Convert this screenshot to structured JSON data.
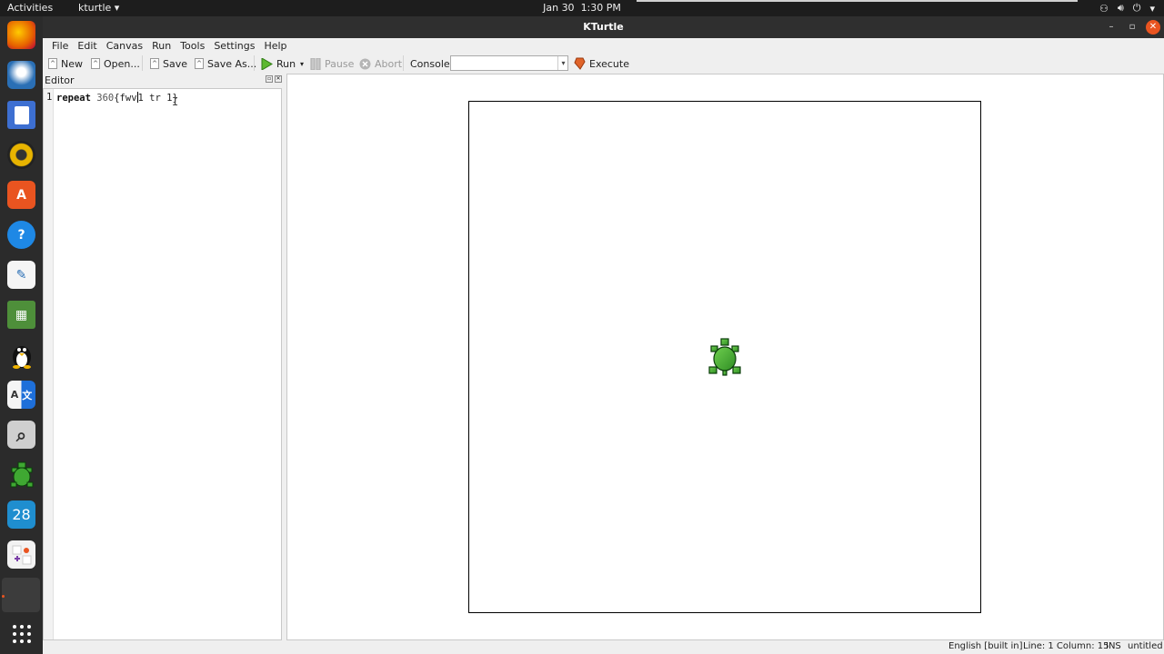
{
  "topbar": {
    "activities": "Activities",
    "app_menu": "kturtle ▾",
    "date": "Jan 30",
    "time": "1:30 PM"
  },
  "dock": {
    "apps": [
      {
        "name": "firefox-icon",
        "glyph": "",
        "color": "#e66000"
      },
      {
        "name": "thunderbird-icon",
        "glyph": "",
        "color": "#2a6fb5"
      },
      {
        "name": "files-icon",
        "glyph": "",
        "color": "#3d6fd1"
      },
      {
        "name": "rhythmbox-icon",
        "glyph": "",
        "color": "#e8b400"
      },
      {
        "name": "software-icon",
        "glyph": "A",
        "color": "#e95420"
      },
      {
        "name": "help-icon",
        "glyph": "?",
        "color": "#1e88e5"
      },
      {
        "name": "text-editor-icon",
        "glyph": "✎",
        "color": "#f5f5f5"
      },
      {
        "name": "calculator-icon",
        "glyph": "▦",
        "color": "#4e8f3a"
      },
      {
        "name": "tux-icon",
        "glyph": "",
        "color": "#2b2b2b"
      },
      {
        "name": "translate-icon",
        "glyph": "A文",
        "color": "#1e6fd9"
      },
      {
        "name": "magnifier-icon",
        "glyph": "⌕",
        "color": "#cfcfcf"
      },
      {
        "name": "kturtle-icon",
        "glyph": "",
        "color": "#2b2b2b"
      },
      {
        "name": "calendar-icon",
        "glyph": "28",
        "color": "#1f8ecf"
      },
      {
        "name": "games-icon",
        "glyph": "",
        "color": "#f2f2f2"
      }
    ],
    "show_apps_glyph": "⋮⋮⋮"
  },
  "window": {
    "title": "KTurtle"
  },
  "menubar": {
    "file": "File",
    "edit": "Edit",
    "canvas": "Canvas",
    "run": "Run",
    "tools": "Tools",
    "settings": "Settings",
    "help": "Help"
  },
  "toolbar": {
    "new": "New",
    "open": "Open...",
    "save": "Save",
    "save_as": "Save As...",
    "run": "Run",
    "pause": "Pause",
    "abort": "Abort",
    "console_label": "Console:",
    "console_value": "",
    "execute": "Execute"
  },
  "editor": {
    "header": "Editor",
    "line_number": "1",
    "code_keyword": "repeat",
    "code_number": " 360",
    "code_before_cursor": "{fwv",
    "code_after_cursor": "1 tr 1}"
  },
  "statusbar": {
    "language": "English [built in]",
    "position": "Line: 1 Column: 15",
    "mode": "INS",
    "file": "untitled"
  },
  "colors": {
    "turtle_green": "#3fa832",
    "ubuntu_orange": "#e95420"
  }
}
